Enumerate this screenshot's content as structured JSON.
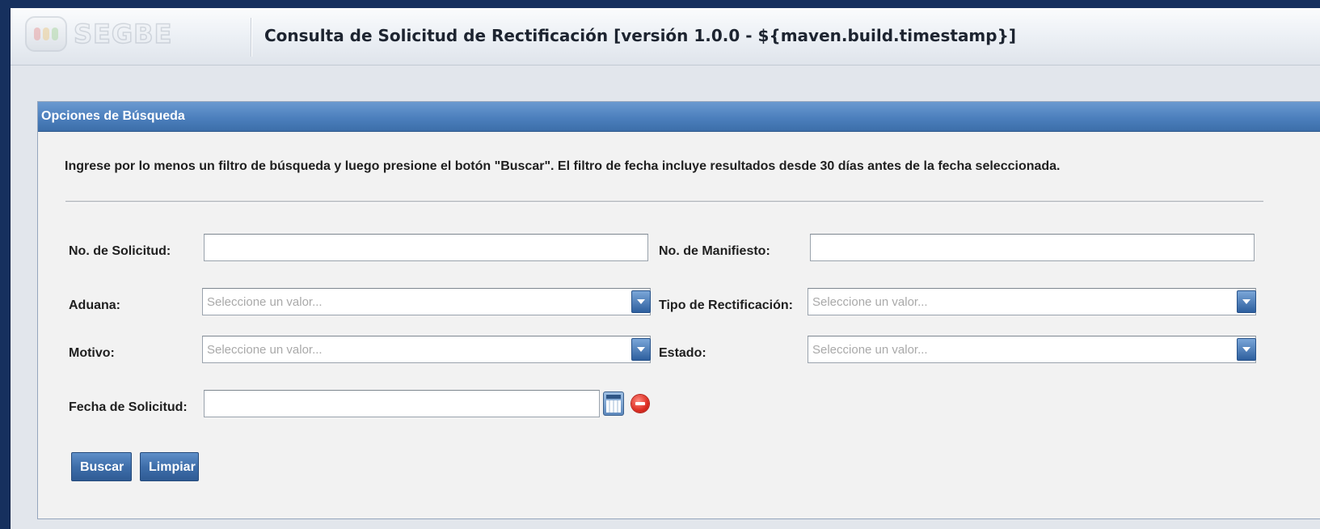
{
  "app": {
    "logo_text": "SEGBE",
    "title": "Consulta de Solicitud de Rectificación [versión 1.0.0 - ${maven.build.timestamp}]"
  },
  "panel": {
    "title": "Opciones de Búsqueda",
    "instructions": "Ingrese por lo menos un filtro de búsqueda y luego presione el botón \"Buscar\". El filtro de fecha incluye resultados desde 30 días antes de la fecha seleccionada."
  },
  "form": {
    "solicitud_label": "No. de Solicitud:",
    "solicitud_value": "",
    "manifiesto_label": "No. de Manifiesto:",
    "manifiesto_value": "",
    "aduana_label": "Aduana:",
    "aduana_placeholder": "Seleccione un valor...",
    "tipo_label": "Tipo de Rectificación:",
    "tipo_placeholder": "Seleccione un valor...",
    "motivo_label": "Motivo:",
    "motivo_placeholder": "Seleccione un valor...",
    "estado_label": "Estado:",
    "estado_placeholder": "Seleccione un valor...",
    "fecha_label": "Fecha de Solicitud:",
    "fecha_value": ""
  },
  "actions": {
    "buscar_label": "Buscar",
    "limpiar_label": "Limpiar"
  },
  "icons": {
    "calendar": "calendar-icon",
    "clear": "clear-icon",
    "dropdown": "chevron-down-icon"
  },
  "colors": {
    "header_blue": "#4c7fbd",
    "button_blue": "#3e6eaa",
    "background_navy": "#16305e"
  }
}
